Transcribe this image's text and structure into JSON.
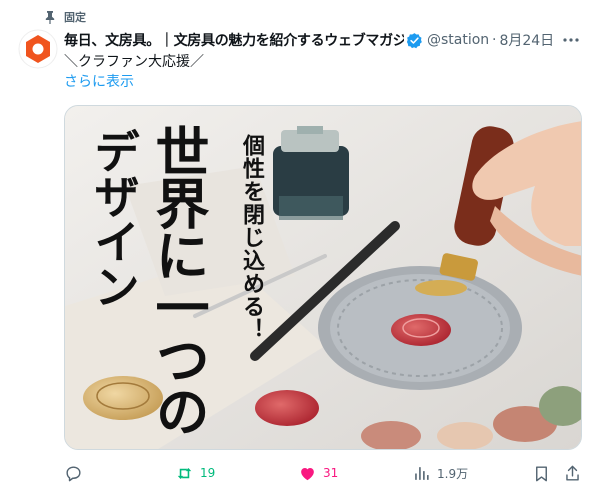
{
  "pinned": {
    "label": "固定",
    "icon": "pin-icon"
  },
  "author": {
    "display_name": "毎日、文房具。｜文房具の魅力を紹介するウェブマガジン",
    "handle": "@stationery",
    "date": "8月24日",
    "verified": true,
    "avatar_color": "#f0541e"
  },
  "tweet": {
    "text": "＼クラファン大応援／",
    "show_more": "さらに表示"
  },
  "media": {
    "overlay_small": "個性を閉じ込める！",
    "overlay_line1": "世界に一つの",
    "overlay_line2": "デザイン"
  },
  "actions": {
    "reply": {
      "icon": "reply-icon",
      "count": ""
    },
    "retweet": {
      "icon": "retweet-icon",
      "count": "19",
      "color": "#00ba7c"
    },
    "like": {
      "icon": "heart-icon",
      "count": "31",
      "color": "#f91880"
    },
    "views": {
      "icon": "views-icon",
      "count": "1.9万"
    },
    "bookmark": {
      "icon": "bookmark-icon"
    },
    "share": {
      "icon": "share-icon"
    }
  }
}
